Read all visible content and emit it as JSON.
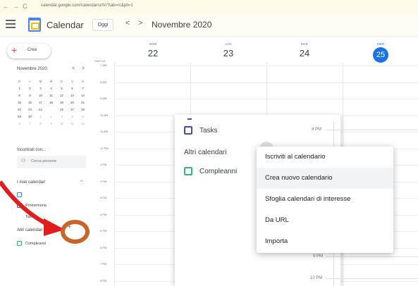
{
  "browser": {
    "url": "calendar.google.com/calendar/u/0/r?tab=rc&pli=1",
    "back": "←",
    "forward": "→",
    "reload": "C"
  },
  "header": {
    "app_title": "Calendar",
    "today_label": "Oggi",
    "prev": "<",
    "next": ">",
    "month": "Novembre 2020"
  },
  "sidebar": {
    "create_label": "Crea",
    "mini_month": "Novembre 2020",
    "mini_prev": "<",
    "mini_next": ">",
    "weekday_heads": [
      "D",
      "L",
      "M",
      "M",
      "G",
      "V",
      "S"
    ],
    "weeks": [
      [
        "1",
        "2",
        "3",
        "4",
        "5",
        "6",
        "7"
      ],
      [
        "8",
        "9",
        "10",
        "11",
        "12",
        "13",
        "14"
      ],
      [
        "15",
        "16",
        "17",
        "18",
        "19",
        "20",
        "21"
      ],
      [
        "22",
        "23",
        "24",
        "25",
        "26",
        "27",
        "28"
      ],
      [
        "29",
        "30",
        "1",
        "2",
        "3",
        "4",
        "5"
      ],
      [
        "6",
        "7",
        "8",
        "9",
        "10",
        "11",
        "12"
      ]
    ],
    "selected_day": "25",
    "meet_label": "Incontrati con...",
    "search_people": "Cerca persone",
    "my_calendars": "I miei calendari",
    "my_cal_items": [
      "",
      "Promemoria",
      "Tasks"
    ],
    "other_calendars": "Altri calendari",
    "other_items": [
      "Compleanni"
    ],
    "add_icon": "+"
  },
  "week": {
    "gmt": "GMT+01",
    "days": [
      {
        "name": "DOM",
        "num": "22"
      },
      {
        "name": "LUN",
        "num": "23"
      },
      {
        "name": "MAR",
        "num": "24"
      },
      {
        "name": "MER",
        "num": "25"
      }
    ],
    "hours": [
      "7 AM",
      "8 AM",
      "9 AM",
      "10 AM",
      "11 AM",
      "12 PM",
      "1 PM",
      "2 PM",
      "3 PM",
      "4 PM",
      "5 PM",
      "6 PM",
      "7 PM",
      "8 PM"
    ]
  },
  "popup": {
    "tasks": "Tasks",
    "altri": "Altri calendari",
    "compleanni": "Compleanni",
    "times": [
      "4 PM",
      "9 PM",
      "10 PM"
    ]
  },
  "menu": {
    "items": [
      "Iscriviti al calendario",
      "Crea nuovo calendario",
      "Sfoglia calendari di interesse",
      "Da URL",
      "Importa"
    ],
    "highlighted_index": 1
  },
  "colors": {
    "accent": "#1a73e8",
    "annotation": "#e01c1c",
    "ring": "#c8652a",
    "tasks_cb": "#3f51b5",
    "compleanni_cb": "#33b679"
  }
}
